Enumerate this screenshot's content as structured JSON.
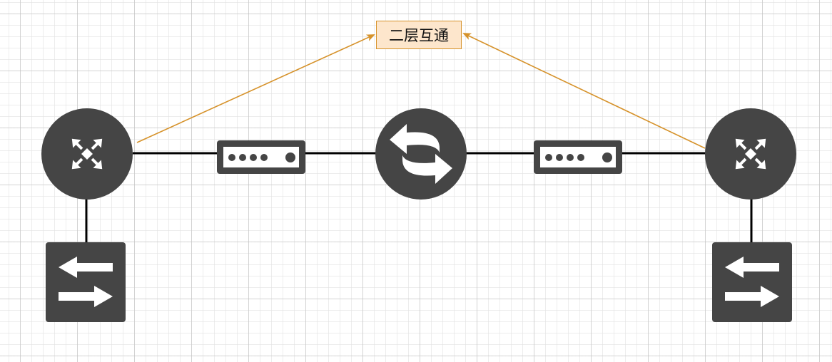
{
  "diagram": {
    "label": "二层互通",
    "colors": {
      "device": "#454545",
      "link": "#000000",
      "arrow": "#d6922a",
      "label_fill": "#fde6cc",
      "label_border": "#d6922a"
    },
    "nodes": [
      {
        "id": "router-left",
        "icon": "router-icon"
      },
      {
        "id": "modem-left",
        "icon": "modem-icon"
      },
      {
        "id": "transport-center",
        "icon": "exchange-arrows-icon"
      },
      {
        "id": "modem-right",
        "icon": "modem-icon"
      },
      {
        "id": "router-right",
        "icon": "router-icon"
      },
      {
        "id": "switch-left",
        "icon": "switch-icon"
      },
      {
        "id": "switch-right",
        "icon": "switch-icon"
      }
    ]
  }
}
